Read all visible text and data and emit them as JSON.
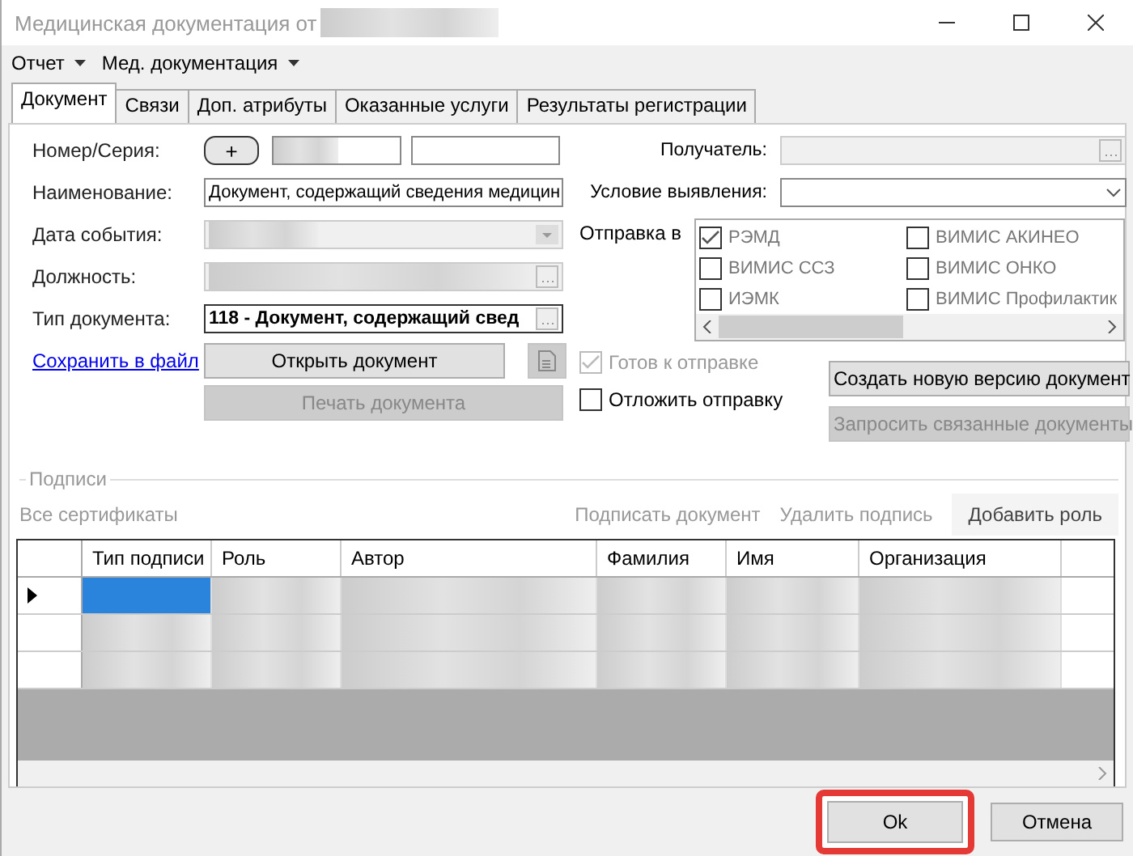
{
  "window": {
    "title": "Медицинская документация от"
  },
  "menu": [
    {
      "label": "Отчет"
    },
    {
      "label": "Мед. документация"
    }
  ],
  "tabs": [
    {
      "label": "Документ",
      "selected": true
    },
    {
      "label": "Связи",
      "selected": false
    },
    {
      "label": "Доп. атрибуты",
      "selected": false
    },
    {
      "label": "Оказанные услуги",
      "selected": false
    },
    {
      "label": "Результаты регистрации",
      "selected": false
    }
  ],
  "form": {
    "number_label": "Номер/Серия:",
    "add_button": "+",
    "name_label": "Наименование:",
    "name_value": "Документ, содержащий сведения медицин",
    "event_date_label": "Дата события:",
    "position_label": "Должность:",
    "doc_type_label": "Тип документа:",
    "doc_type_value": "118 - Документ, содержащий свед",
    "save_link": "Сохранить в файл",
    "recipient_label": "Получатель:",
    "condition_label": "Условие выявления:",
    "send_to_label": "Отправка в"
  },
  "send_targets": [
    {
      "label": "РЭМД",
      "checked": true
    },
    {
      "label": "ВИМИС АКИНЕО",
      "checked": false
    },
    {
      "label": "ВИМИС ССЗ",
      "checked": false
    },
    {
      "label": "ВИМИС ОНКО",
      "checked": false
    },
    {
      "label": "ИЭМК",
      "checked": false
    },
    {
      "label": "ВИМИС Профилактик",
      "checked": false
    }
  ],
  "options": [
    {
      "label": "Готов к отправке",
      "checked": true,
      "disabled": true
    },
    {
      "label": "Отложить отправку",
      "checked": false,
      "disabled": false
    }
  ],
  "open_button": {
    "label": "Открыть документ",
    "disabled": false
  },
  "file_button": {
    "disabled": true
  },
  "print_button": {
    "label": "Печать документа",
    "disabled": true
  },
  "new_version_button": {
    "label": "Создать новую версию документ",
    "disabled": false
  },
  "request_button": {
    "label": "Запросить связанные документы",
    "disabled": true
  },
  "signatures": {
    "title": "Подписи",
    "all_certs": {
      "label": "Все сертификаты",
      "disabled": true
    },
    "actions": [
      {
        "label": "Подписать документ",
        "disabled": true
      },
      {
        "label": "Удалить подпись",
        "disabled": true
      }
    ],
    "add_role_button": "Добавить роль",
    "columns": [
      "Тип подписи",
      "Роль",
      "Автор",
      "Фамилия",
      "Имя",
      "Организация"
    ],
    "rows": [
      {
        "selected": true
      },
      {
        "selected": false
      },
      {
        "selected": false
      }
    ]
  },
  "footer": [
    {
      "label": "Ok",
      "highlighted": true
    },
    {
      "label": "Отмена",
      "highlighted": false
    }
  ]
}
